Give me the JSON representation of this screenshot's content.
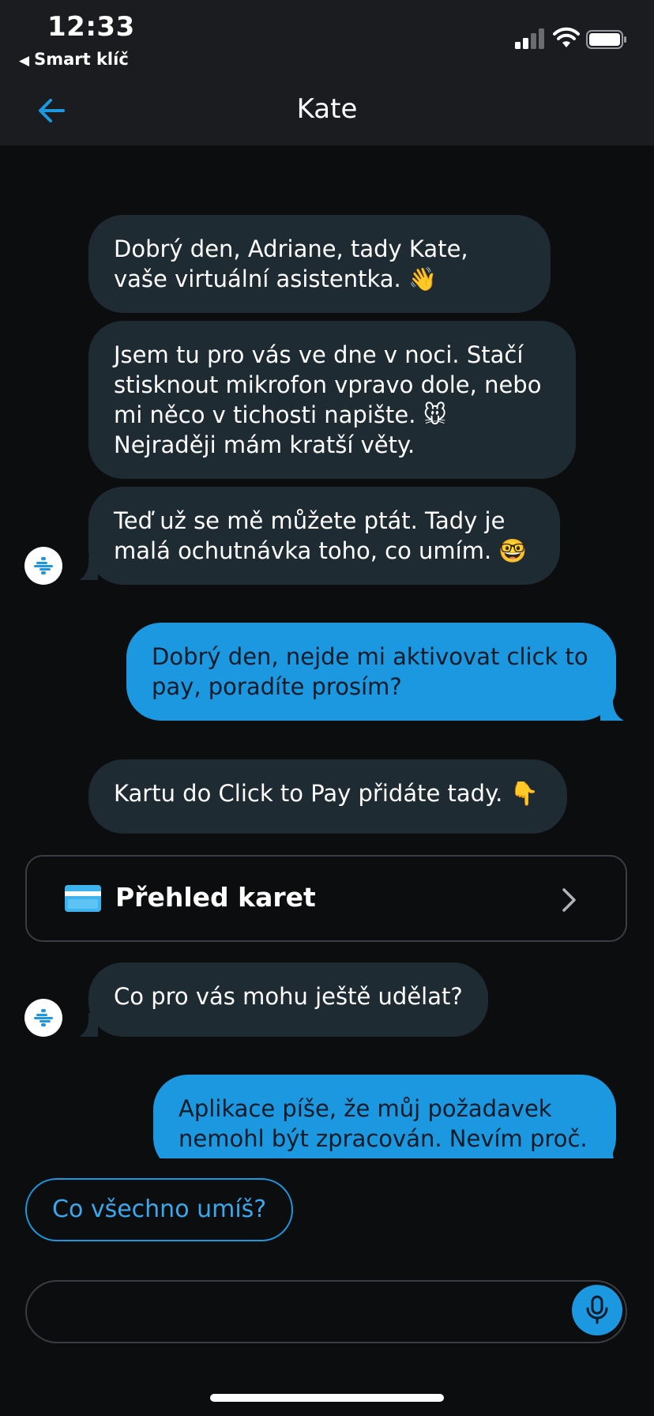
{
  "status_bar": {
    "time": "12:33",
    "back_app": "Smart klíč"
  },
  "header": {
    "title": "Kate"
  },
  "messages": {
    "m1": "Dobrý den, Adriane, tady Kate, vaše virtuální asistentka. 👋",
    "m2": "Jsem tu pro vás ve dne v noci. Stačí stisknout mikrofon vpravo dole, nebo mi něco v tichosti napište. 🐭 Nejraději mám kratší věty.",
    "m3": "Teď už se mě můžete ptát. Tady je malá ochutnávka toho, co umím. 🤓",
    "m4": "Dobrý den, nejde mi aktivovat click to pay, poradíte prosím?",
    "m5": "Kartu do Click to Pay přidáte tady. 👇",
    "m6": "Co pro vás mohu ještě udělat?",
    "m7": "Aplikace píše, že můj požadavek nemohl být zpracován. Nevím proč."
  },
  "card_link": {
    "label": "Přehled karet",
    "icon": "credit-card-icon"
  },
  "suggestion": {
    "label": "Co všechno umíš?"
  },
  "input": {
    "placeholder": ""
  },
  "colors": {
    "accent": "#1b98e0",
    "bot_bubble": "#1f2b33",
    "background": "#0c0d0f"
  }
}
